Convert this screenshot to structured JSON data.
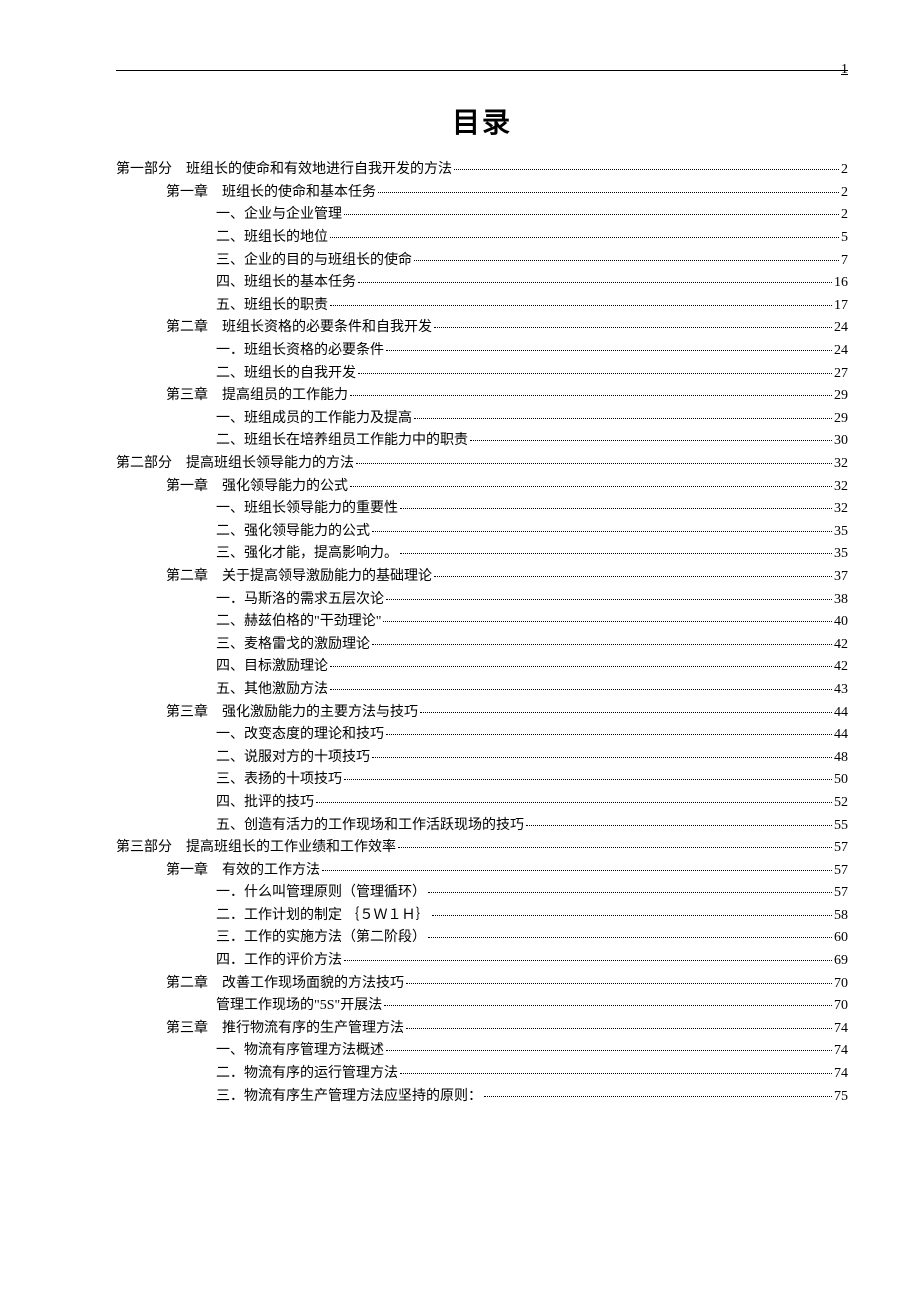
{
  "page_number": "1",
  "title": "目录",
  "toc": [
    {
      "level": 0,
      "prefix": "第一部分",
      "text": "班组长的使命和有效地进行自我开发的方法",
      "page": "2"
    },
    {
      "level": 1,
      "prefix": "第一章",
      "text": "班组长的使命和基本任务",
      "page": "2"
    },
    {
      "level": 2,
      "prefix": "一、",
      "text": "企业与企业管理",
      "page": "2"
    },
    {
      "level": 2,
      "prefix": "二、",
      "text": "班组长的地位",
      "page": "5"
    },
    {
      "level": 2,
      "prefix": "三、",
      "text": "企业的目的与班组长的使命",
      "page": "7"
    },
    {
      "level": 2,
      "prefix": "四、",
      "text": "班组长的基本任务",
      "page": "16"
    },
    {
      "level": 2,
      "prefix": "五、",
      "text": "班组长的职责",
      "page": "17"
    },
    {
      "level": 1,
      "prefix": "第二章",
      "text": "班组长资格的必要条件和自我开发",
      "page": "24"
    },
    {
      "level": 2,
      "prefix": "一．",
      "text": "班组长资格的必要条件",
      "page": "24"
    },
    {
      "level": 2,
      "prefix": "二、",
      "text": "班组长的自我开发",
      "page": "27"
    },
    {
      "level": 1,
      "prefix": "第三章",
      "text": "提高组员的工作能力",
      "page": "29"
    },
    {
      "level": 2,
      "prefix": "一、",
      "text": "班组成员的工作能力及提高",
      "page": "29"
    },
    {
      "level": 2,
      "prefix": "二、",
      "text": "班组长在培养组员工作能力中的职责",
      "page": "30"
    },
    {
      "level": 0,
      "prefix": "第二部分",
      "text": "提高班组长领导能力的方法",
      "page": "32"
    },
    {
      "level": 1,
      "prefix": "第一章",
      "text": "强化领导能力的公式",
      "page": "32"
    },
    {
      "level": 2,
      "prefix": "一、",
      "text": "班组长领导能力的重要性",
      "page": "32"
    },
    {
      "level": 2,
      "prefix": "二、",
      "text": "强化领导能力的公式",
      "page": "35"
    },
    {
      "level": 2,
      "prefix": "三、",
      "text": "强化才能，提高影响力。",
      "page": "35"
    },
    {
      "level": 1,
      "prefix": "第二章",
      "text": "关于提高领导激励能力的基础理论",
      "page": "37"
    },
    {
      "level": 2,
      "prefix": "一．",
      "text": "马斯洛的需求五层次论",
      "page": "38"
    },
    {
      "level": 2,
      "prefix": "二、",
      "text": "赫兹伯格的\"干劲理论\"",
      "page": "40"
    },
    {
      "level": 2,
      "prefix": "三、",
      "text": "麦格雷戈的激励理论",
      "page": "42"
    },
    {
      "level": 2,
      "prefix": "四、",
      "text": "目标激励理论",
      "page": "42"
    },
    {
      "level": 2,
      "prefix": "五、",
      "text": "其他激励方法",
      "page": "43"
    },
    {
      "level": 1,
      "prefix": "第三章",
      "text": "强化激励能力的主要方法与技巧",
      "page": "44"
    },
    {
      "level": 2,
      "prefix": "一、",
      "text": "改变态度的理论和技巧",
      "page": "44"
    },
    {
      "level": 2,
      "prefix": "二、",
      "text": "说服对方的十项技巧",
      "page": "48"
    },
    {
      "level": 2,
      "prefix": "三、",
      "text": "表扬的十项技巧",
      "page": "50"
    },
    {
      "level": 2,
      "prefix": "四、",
      "text": "批评的技巧",
      "page": "52"
    },
    {
      "level": 2,
      "prefix": "五、",
      "text": "创造有活力的工作现场和工作活跃现场的技巧",
      "page": "55"
    },
    {
      "level": 0,
      "prefix": "第三部分",
      "text": "提高班组长的工作业绩和工作效率",
      "page": "57"
    },
    {
      "level": 1,
      "prefix": "第一章",
      "text": "有效的工作方法",
      "page": "57"
    },
    {
      "level": 2,
      "prefix": "一．",
      "text": "什么叫管理原则（管理循环）",
      "page": "57"
    },
    {
      "level": 2,
      "prefix": "二．",
      "text": "工作计划的制定 ｛５Ｗ１Ｈ｝",
      "page": "58"
    },
    {
      "level": 2,
      "prefix": "三．",
      "text": "工作的实施方法（第二阶段）",
      "page": "60"
    },
    {
      "level": 2,
      "prefix": "四．",
      "text": "工作的评价方法",
      "page": "69"
    },
    {
      "level": 1,
      "prefix": "第二章",
      "text": "改善工作现场面貌的方法技巧",
      "page": "70"
    },
    {
      "level": 2,
      "prefix": "",
      "text": "管理工作现场的\"5S\"开展法",
      "page": "70"
    },
    {
      "level": 1,
      "prefix": "第三章",
      "text": "推行物流有序的生产管理方法",
      "page": "74"
    },
    {
      "level": 2,
      "prefix": "一、",
      "text": "物流有序管理方法概述",
      "page": "74"
    },
    {
      "level": 2,
      "prefix": "二．",
      "text": "物流有序的运行管理方法",
      "page": "74"
    },
    {
      "level": 2,
      "prefix": "三．",
      "text": "物流有序生产管理方法应坚持的原则：",
      "page": "75"
    }
  ]
}
